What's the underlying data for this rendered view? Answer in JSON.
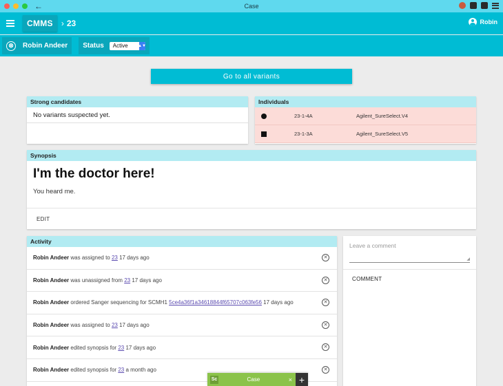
{
  "window": {
    "title": "Case"
  },
  "header": {
    "brand": "CMMS",
    "crumb_sep": "›",
    "case_id": "23",
    "user_name": "Robin"
  },
  "subbar": {
    "assignee": "Robin Andeer",
    "remove_glyph": "⊗",
    "status_label": "Status",
    "status_value": "Active"
  },
  "goto_button": "Go to all variants",
  "strong_candidates": {
    "title": "Strong candidates",
    "empty_text": "No variants suspected yet."
  },
  "individuals": {
    "title": "Individuals",
    "rows": [
      {
        "symbol": "circle",
        "id": "23-1-4A",
        "capture": "Agilent_SureSelect.V4"
      },
      {
        "symbol": "square",
        "id": "23-1-3A",
        "capture": "Agilent_SureSelect.V5"
      }
    ]
  },
  "synopsis": {
    "title": "Synopsis",
    "heading": "I'm the doctor here!",
    "text": "You heard me.",
    "edit_label": "EDIT"
  },
  "activity": {
    "title": "Activity",
    "rows": [
      {
        "user": "Robin Andeer",
        "action": " was assigned to ",
        "link": "23",
        "time": " 17 days ago"
      },
      {
        "user": "Robin Andeer",
        "action": " was unassigned from ",
        "link": "23",
        "time": " 17 days ago"
      },
      {
        "user": "Robin Andeer",
        "action": " ordered Sanger sequencing for SCMH1 ",
        "link": "5ce4a36f1a34618844f65707c063fe56",
        "time": " 17 days ago"
      },
      {
        "user": "Robin Andeer",
        "action": " was assigned to ",
        "link": "23",
        "time": " 17 days ago"
      },
      {
        "user": "Robin Andeer",
        "action": " edited synopsis for ",
        "link": "23",
        "time": " 17 days ago"
      },
      {
        "user": "Robin Andeer",
        "action": " edited synopsis for ",
        "link": "23",
        "time": " a month ago"
      }
    ]
  },
  "comment": {
    "placeholder": "Leave a comment",
    "button": "COMMENT"
  },
  "extension_bar": {
    "logo": "Sc",
    "tab_label": "Case",
    "close": "×",
    "add": "+"
  }
}
